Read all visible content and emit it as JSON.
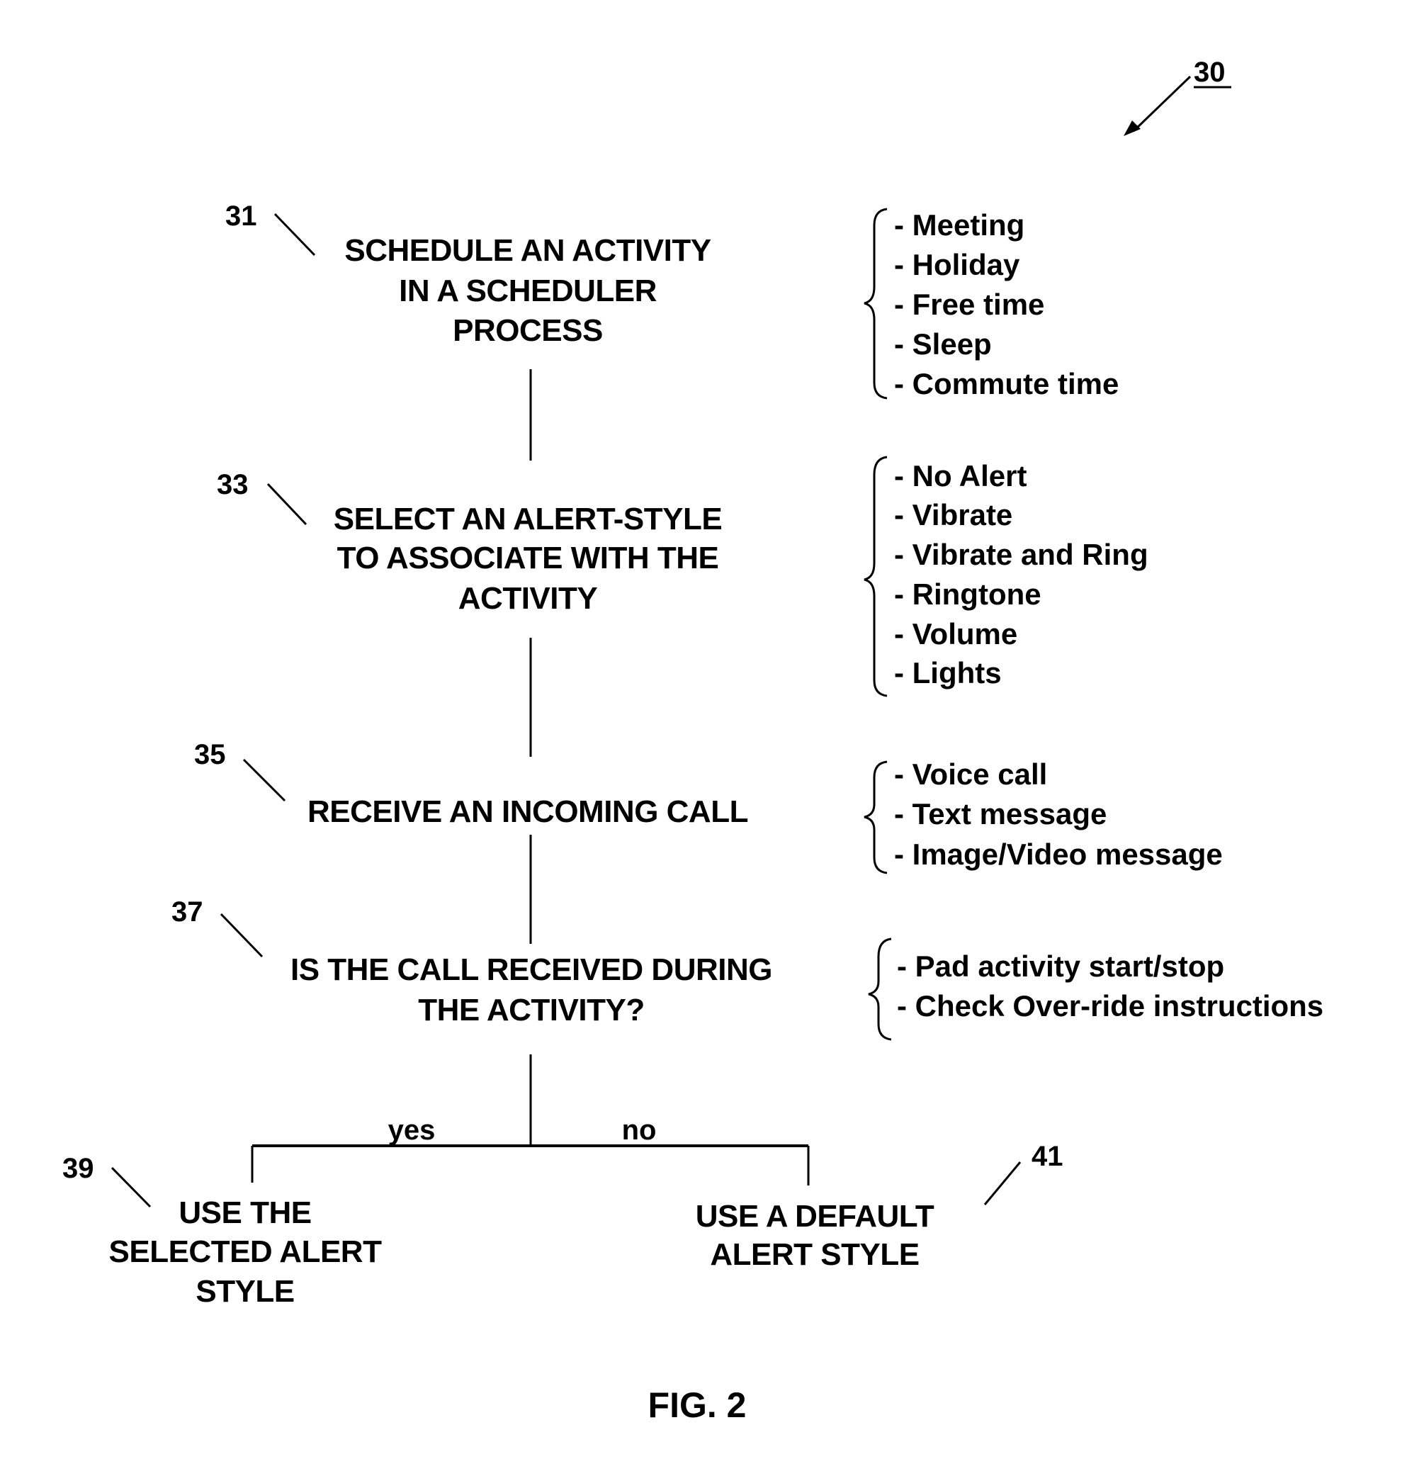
{
  "figure": {
    "reference_number": "30",
    "label": "FIG. 2"
  },
  "steps": [
    {
      "id": "31",
      "lines": [
        "SCHEDULE AN ACTIVITY",
        "IN A SCHEDULER",
        "PROCESS"
      ],
      "options": [
        "- Meeting",
        "- Holiday",
        "- Free time",
        "- Sleep",
        "- Commute time"
      ]
    },
    {
      "id": "33",
      "lines": [
        "SELECT AN ALERT-STYLE",
        "TO ASSOCIATE WITH THE",
        "ACTIVITY"
      ],
      "options": [
        "- No Alert",
        "- Vibrate",
        "- Vibrate and Ring",
        "- Ringtone",
        "- Volume",
        "- Lights"
      ]
    },
    {
      "id": "35",
      "lines": [
        "RECEIVE AN INCOMING CALL"
      ],
      "options": [
        "- Voice call",
        "- Text message",
        "- Image/Video message"
      ]
    },
    {
      "id": "37",
      "lines": [
        "IS THE CALL RECEIVED DURING",
        "THE ACTIVITY?"
      ],
      "options": [
        "- Pad activity start/stop",
        "- Check Over-ride instructions"
      ]
    }
  ],
  "branches": {
    "yes_label": "yes",
    "no_label": "no",
    "yes": {
      "id": "39",
      "lines": [
        "USE THE",
        "SELECTED ALERT",
        "STYLE"
      ]
    },
    "no": {
      "id": "41",
      "lines": [
        "USE A DEFAULT",
        "ALERT STYLE"
      ]
    }
  }
}
